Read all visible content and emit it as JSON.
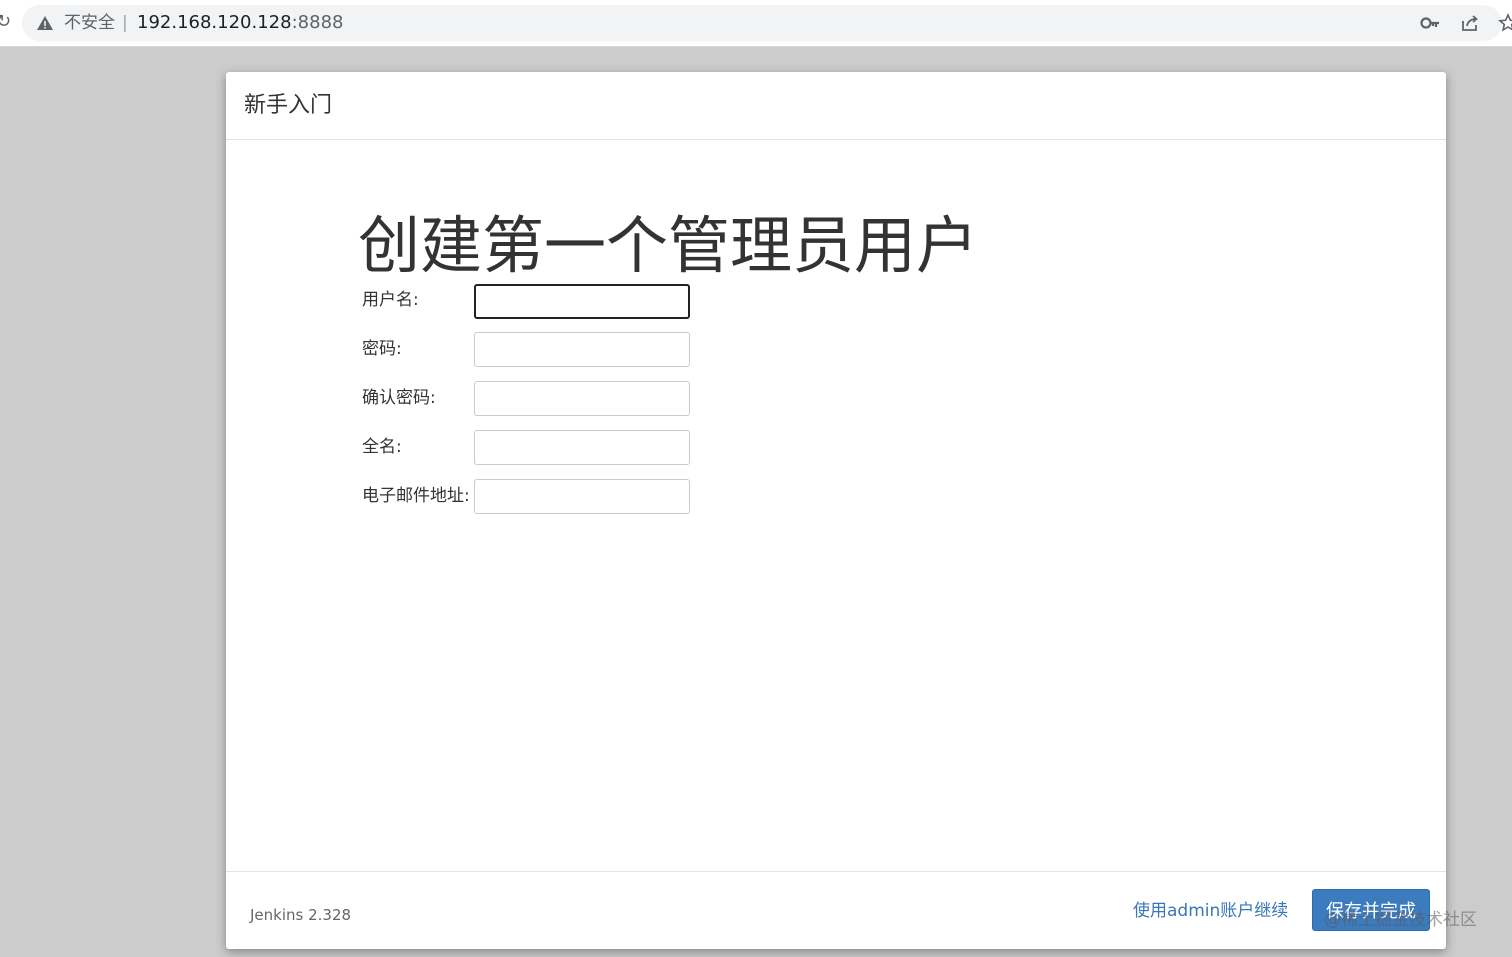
{
  "browser": {
    "insecure_label": "不安全",
    "separator": "|",
    "url_host": "192.168.120.128",
    "url_port": ":8888"
  },
  "dialog": {
    "title": "新手入门",
    "heading": "创建第一个管理员用户",
    "fields": [
      {
        "label": "用户名:",
        "value": ""
      },
      {
        "label": "密码:",
        "value": ""
      },
      {
        "label": "确认密码:",
        "value": ""
      },
      {
        "label": "全名:",
        "value": ""
      },
      {
        "label": "电子邮件地址:",
        "value": ""
      }
    ],
    "footer": {
      "version": "Jenkins 2.328",
      "continue_link": "使用admin账户继续",
      "save_button": "保存并完成"
    }
  },
  "watermark": "@稀土掘金技术社区",
  "colors": {
    "accent": "#3c7bbd",
    "link": "#3a77b8",
    "backdrop": "#cccccc"
  }
}
